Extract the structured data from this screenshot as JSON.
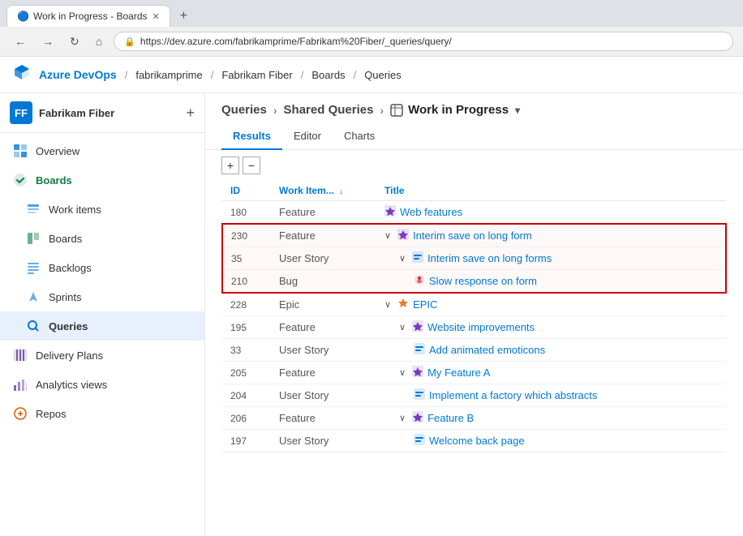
{
  "browser": {
    "tab_title": "Work in Progress - Boards",
    "url": "https://dev.azure.com/fabrikamprime/Fabrikam%20Fiber/_queries/query/",
    "favicon": "🔵"
  },
  "topnav": {
    "brand": "Azure DevOps",
    "org": "fabrikamprime",
    "project": "Fabrikam Fiber",
    "area": "Boards",
    "page": "Queries"
  },
  "sidebar": {
    "project_initial": "FF",
    "project_name": "Fabrikam Fiber",
    "add_label": "+",
    "nav_items": [
      {
        "id": "overview",
        "label": "Overview",
        "icon": "📋"
      },
      {
        "id": "boards",
        "label": "Boards",
        "icon": "✅"
      },
      {
        "id": "workitems",
        "label": "Work items",
        "icon": "📄"
      },
      {
        "id": "boards2",
        "label": "Boards",
        "icon": "📊"
      },
      {
        "id": "backlogs",
        "label": "Backlogs",
        "icon": "☰"
      },
      {
        "id": "sprints",
        "label": "Sprints",
        "icon": "⚡"
      },
      {
        "id": "queries",
        "label": "Queries",
        "icon": "🔍",
        "active": true
      },
      {
        "id": "delivery",
        "label": "Delivery Plans",
        "icon": "📅"
      },
      {
        "id": "analytics",
        "label": "Analytics views",
        "icon": "📈"
      },
      {
        "id": "repos",
        "label": "Repos",
        "icon": "🔧"
      }
    ]
  },
  "breadcrumb": {
    "items": [
      {
        "label": "Queries"
      },
      {
        "label": "Shared Queries"
      },
      {
        "label": "Work in Progress",
        "icon": "table",
        "dropdown": true
      }
    ]
  },
  "tabs": [
    {
      "id": "results",
      "label": "Results",
      "active": true
    },
    {
      "id": "editor",
      "label": "Editor",
      "active": false
    },
    {
      "id": "charts",
      "label": "Charts",
      "active": false
    }
  ],
  "table": {
    "columns": [
      {
        "id": "id",
        "label": "ID"
      },
      {
        "id": "workitemtype",
        "label": "Work Item...",
        "sortable": true
      },
      {
        "id": "title",
        "label": "Title"
      }
    ],
    "rows": [
      {
        "id": "180",
        "type": "Feature",
        "type_icon": "feature",
        "title": "Web features",
        "indent": 1,
        "expandable": false,
        "highlighted": false
      },
      {
        "id": "230",
        "type": "Feature",
        "type_icon": "feature",
        "title": "Interim save on long form",
        "indent": 1,
        "expandable": true,
        "highlighted": true
      },
      {
        "id": "35",
        "type": "User Story",
        "type_icon": "story",
        "title": "Interim save on long forms",
        "indent": 2,
        "expandable": true,
        "highlighted": true
      },
      {
        "id": "210",
        "type": "Bug",
        "type_icon": "bug",
        "title": "Slow response on form",
        "indent": 3,
        "expandable": false,
        "highlighted": true
      },
      {
        "id": "228",
        "type": "Epic",
        "type_icon": "epic",
        "title": "EPIC",
        "indent": 1,
        "expandable": true,
        "highlighted": false
      },
      {
        "id": "195",
        "type": "Feature",
        "type_icon": "feature",
        "title": "Website improvements",
        "indent": 2,
        "expandable": true,
        "highlighted": false
      },
      {
        "id": "33",
        "type": "User Story",
        "type_icon": "story",
        "title": "Add animated emoticons",
        "indent": 3,
        "expandable": false,
        "highlighted": false
      },
      {
        "id": "205",
        "type": "Feature",
        "type_icon": "feature",
        "title": "My Feature A",
        "indent": 2,
        "expandable": true,
        "highlighted": false
      },
      {
        "id": "204",
        "type": "User Story",
        "type_icon": "story",
        "title": "Implement a factory which abstracts",
        "indent": 3,
        "expandable": false,
        "highlighted": false
      },
      {
        "id": "206",
        "type": "Feature",
        "type_icon": "feature",
        "title": "Feature B",
        "indent": 2,
        "expandable": true,
        "highlighted": false
      },
      {
        "id": "197",
        "type": "User Story",
        "type_icon": "story",
        "title": "Welcome back page",
        "indent": 3,
        "expandable": false,
        "highlighted": false
      }
    ]
  }
}
